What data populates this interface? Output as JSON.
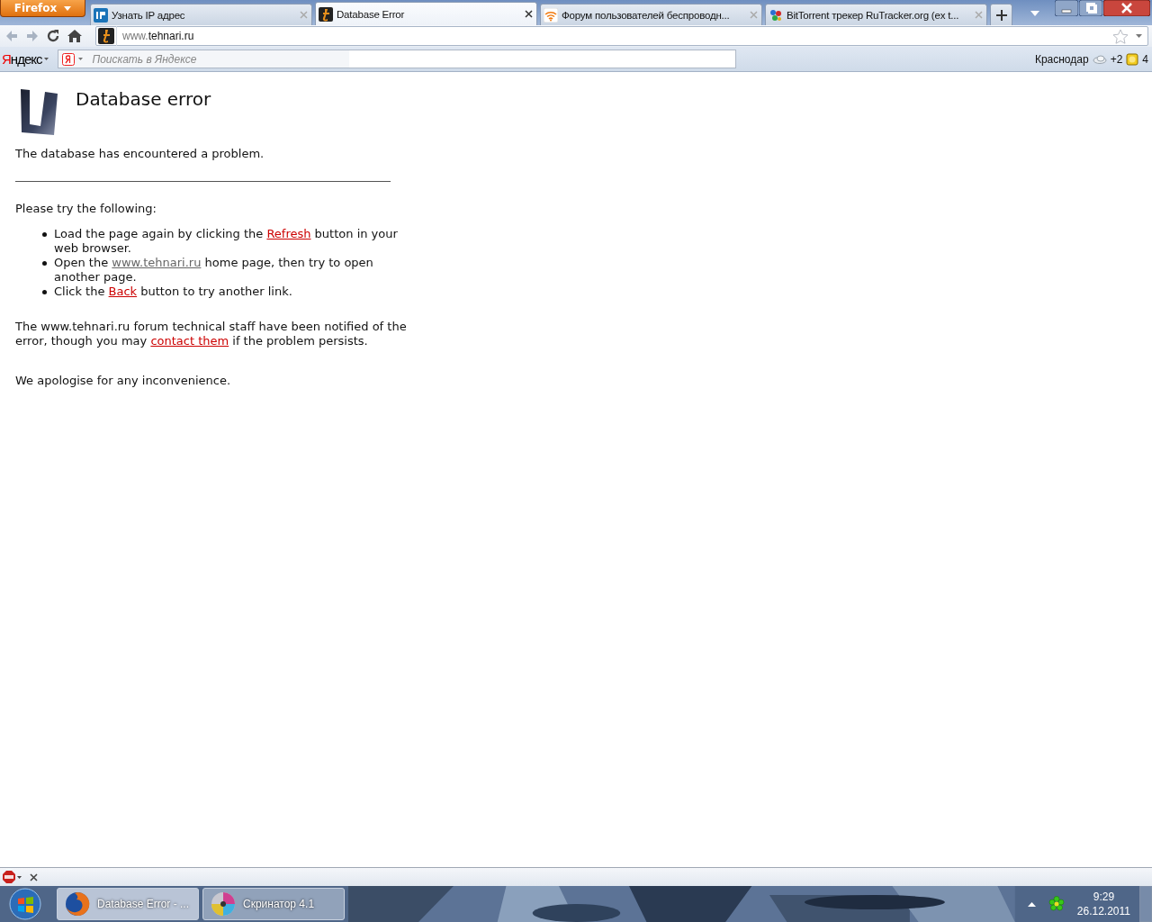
{
  "browser": {
    "menu_button": "Firefox",
    "tabs": [
      {
        "title": "Узнать IP адрес",
        "selected": false,
        "kind": "ip"
      },
      {
        "title": "Database Error",
        "selected": true,
        "kind": "site"
      },
      {
        "title": "Форум пользователей беспроводн...",
        "selected": false,
        "kind": "wifi"
      },
      {
        "title": "BitTorrent трекер RuTracker.org (ex t...",
        "selected": false,
        "kind": "torrent"
      }
    ],
    "address": {
      "prefix": "www.",
      "host": "tehnari.ru"
    },
    "yandex_bar": {
      "logo": "Яндекс",
      "search_placeholder": "Поискать в Яндексе",
      "city": "Краснодар",
      "temperature": "+2",
      "mail_count": "4"
    }
  },
  "page": {
    "heading": "Database error",
    "intro": "The database has encountered a problem.",
    "try_label": "Please try the following:",
    "suggestions": [
      [
        {
          "text": "Load the page again by clicking the "
        },
        {
          "link": "Refresh",
          "visited": false
        },
        {
          "text": " button in your web browser."
        }
      ],
      [
        {
          "text": "Open the "
        },
        {
          "link": "www.tehnari.ru",
          "visited": true
        },
        {
          "text": " home page, then try to open another page."
        }
      ],
      [
        {
          "text": "Click the "
        },
        {
          "link": "Back",
          "visited": false
        },
        {
          "text": " button to try another link."
        }
      ]
    ],
    "notice": [
      {
        "text": "The www.tehnari.ru forum technical staff have been notified of the error, though you may "
      },
      {
        "link": "contact them",
        "visited": false
      },
      {
        "text": " if the problem persists."
      }
    ],
    "apology": "We apologise for any inconvenience."
  },
  "taskbar": {
    "tasks": [
      {
        "label": "Database Error - ...",
        "selected": true,
        "kind": "firefox"
      },
      {
        "label": "Скринатор 4.1",
        "selected": false,
        "kind": "disc"
      }
    ],
    "time": "9:29",
    "date": "26.12.2011"
  }
}
